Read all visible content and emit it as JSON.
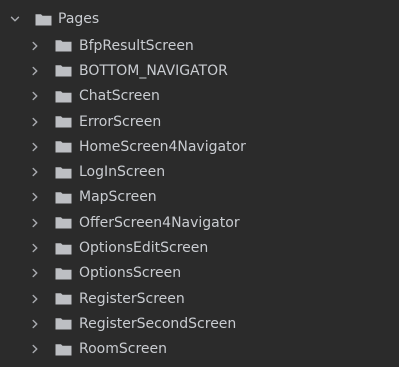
{
  "tree": {
    "root": {
      "label": "Pages",
      "icon": "folder-icon",
      "expanded": true
    },
    "children": [
      {
        "label": "BfpResultScreen",
        "icon": "folder-icon",
        "expanded": false
      },
      {
        "label": "BOTTOM_NAVIGATOR",
        "icon": "folder-icon",
        "expanded": false
      },
      {
        "label": "ChatScreen",
        "icon": "folder-icon",
        "expanded": false
      },
      {
        "label": "ErrorScreen",
        "icon": "folder-icon",
        "expanded": false
      },
      {
        "label": "HomeScreen4Navigator",
        "icon": "folder-icon",
        "expanded": false
      },
      {
        "label": "LogInScreen",
        "icon": "folder-icon",
        "expanded": false
      },
      {
        "label": "MapScreen",
        "icon": "folder-icon",
        "expanded": false
      },
      {
        "label": "OfferScreen4Navigator",
        "icon": "folder-icon",
        "expanded": false
      },
      {
        "label": "OptionsEditScreen",
        "icon": "folder-icon",
        "expanded": false
      },
      {
        "label": "OptionsScreen",
        "icon": "folder-icon",
        "expanded": false
      },
      {
        "label": "RegisterScreen",
        "icon": "folder-icon",
        "expanded": false
      },
      {
        "label": "RegisterSecondScreen",
        "icon": "folder-icon",
        "expanded": false
      },
      {
        "label": "RoomScreen",
        "icon": "folder-icon",
        "expanded": false
      }
    ]
  },
  "colors": {
    "background": "#2b2b2b",
    "text": "#c9ccd1",
    "folder": "#bdbfc3",
    "chevron": "#a9abb0"
  }
}
